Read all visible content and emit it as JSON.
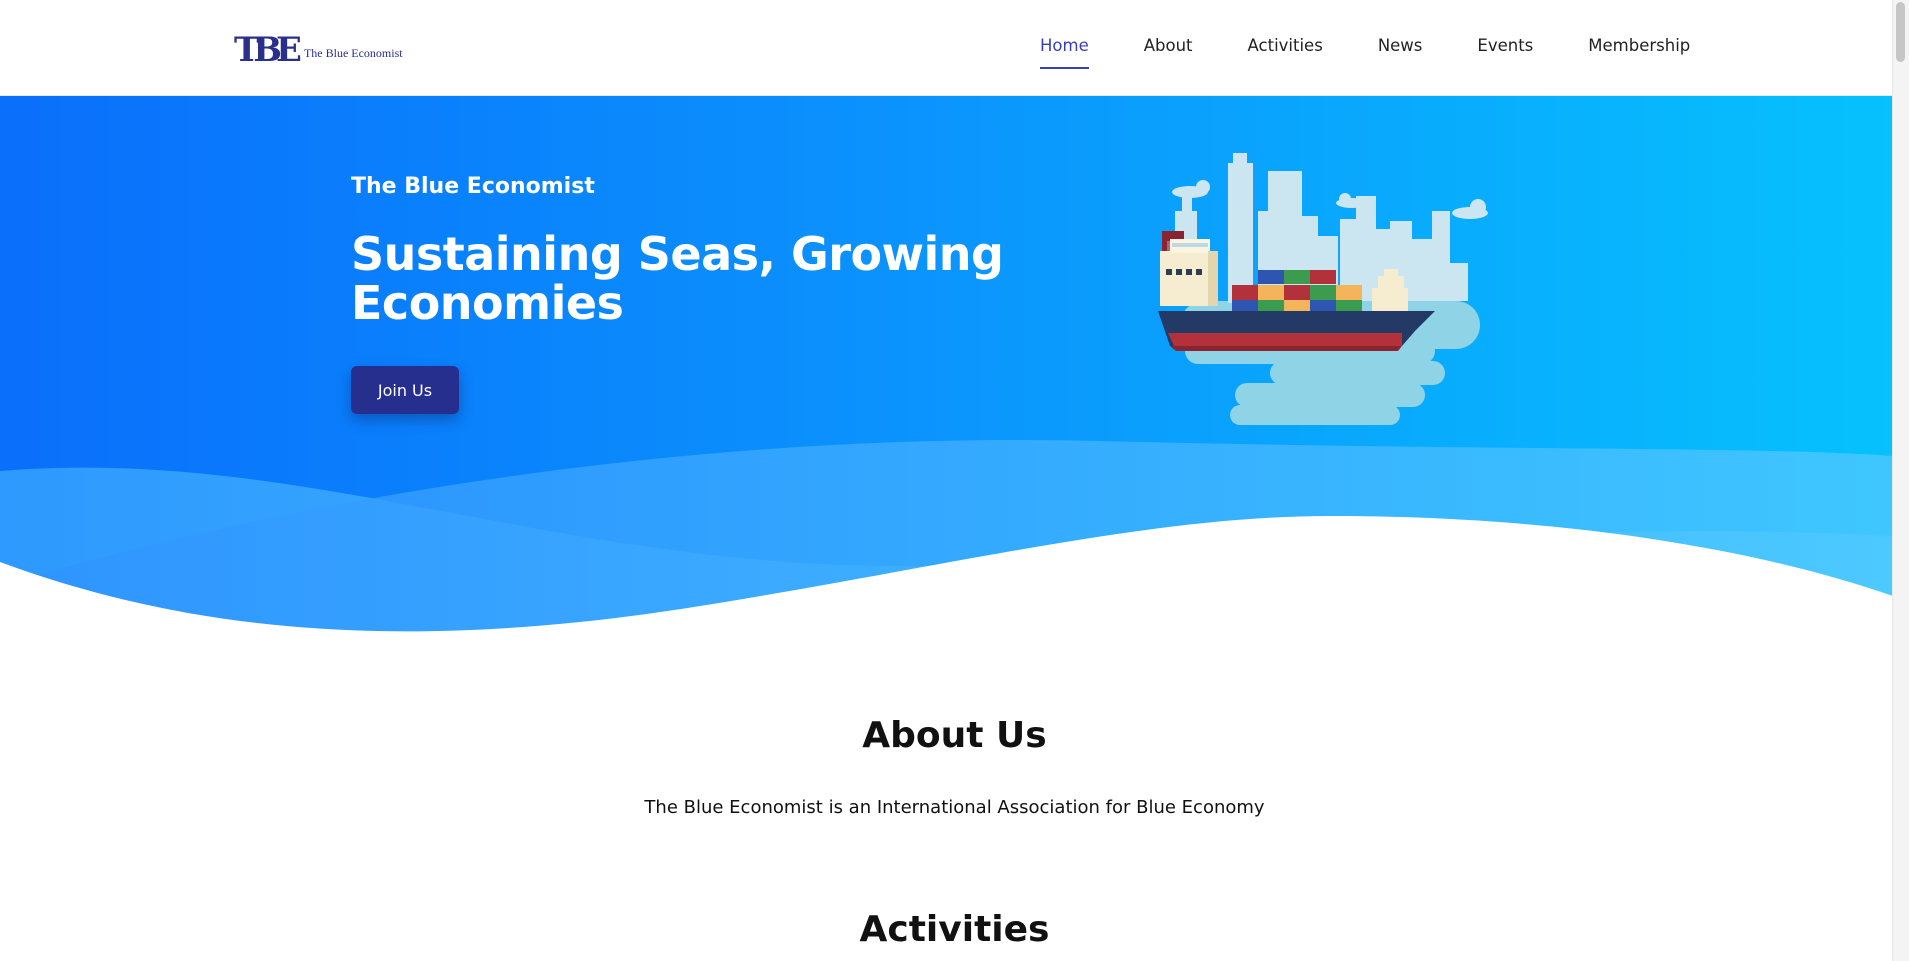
{
  "brand": {
    "logo_mark": "TBE",
    "name": "The Blue Economist"
  },
  "nav": {
    "items": [
      {
        "label": "Home",
        "active": true
      },
      {
        "label": "About"
      },
      {
        "label": "Activities"
      },
      {
        "label": "News"
      },
      {
        "label": "Events"
      },
      {
        "label": "Membership"
      }
    ]
  },
  "hero": {
    "subtitle": "The Blue Economist",
    "title": "Sustaining Seas, Growing Economies",
    "cta_label": "Join Us",
    "illustration": "cargo-ship-city-illustration"
  },
  "about": {
    "title": "About Us",
    "text": "The Blue Economist is an International Association for Blue Economy"
  },
  "activities": {
    "title": "Activities"
  },
  "colors": {
    "brand": "#2b2f8c",
    "nav_active": "#3b3fb6",
    "hero_start": "#0a6ffb",
    "hero_end": "#06c1fd",
    "button": "#262e8e"
  }
}
